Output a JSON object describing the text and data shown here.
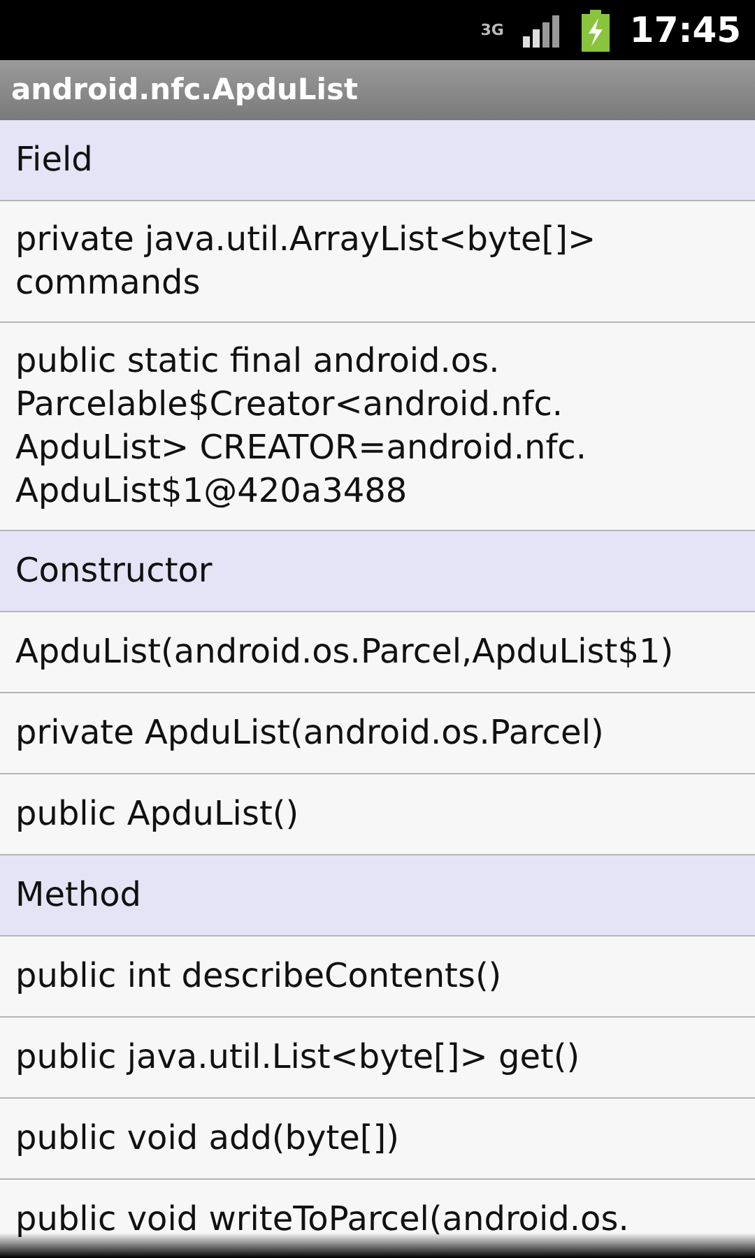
{
  "status_bar": {
    "time": "17:45",
    "network": "3G"
  },
  "title_bar": {
    "title": "android.nfc.ApduList"
  },
  "list": [
    {
      "kind": "header",
      "text": "Field"
    },
    {
      "kind": "member",
      "text": "private java.util.ArrayList<byte[]> commands"
    },
    {
      "kind": "member",
      "text": "public static final android.os. Parcelable$Creator<android.nfc. ApduList> CREATOR=android.nfc. ApduList$1@420a3488"
    },
    {
      "kind": "header",
      "text": "Constructor"
    },
    {
      "kind": "member",
      "text": "ApduList(android.os.Parcel,ApduList$1)"
    },
    {
      "kind": "member",
      "text": "private ApduList(android.os.Parcel)"
    },
    {
      "kind": "member",
      "text": "public ApduList()"
    },
    {
      "kind": "header",
      "text": "Method"
    },
    {
      "kind": "member",
      "text": "public int describeContents()"
    },
    {
      "kind": "member",
      "text": "public java.util.List<byte[]> get()"
    },
    {
      "kind": "member",
      "text": "public void add(byte[])"
    },
    {
      "kind": "member",
      "text": "public void writeToParcel(android.os."
    }
  ]
}
